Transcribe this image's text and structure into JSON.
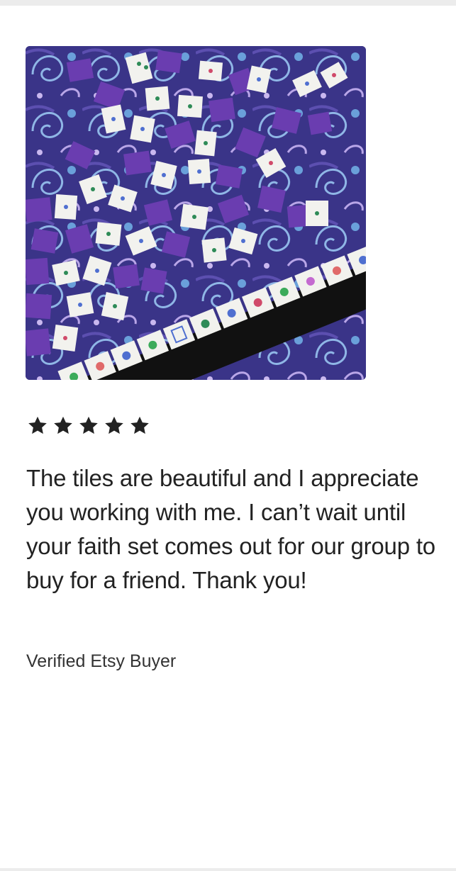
{
  "review": {
    "rating": 5,
    "rating_max": 5,
    "star_color": "#222222",
    "text": "The tiles are beautiful and I appreciate you working with me. I can’t wait until your faith set comes out for our group to buy for a friend. Thank you!",
    "reviewer": "Verified Etsy Buyer",
    "photo_icon": "mahjong-tiles-photo"
  }
}
